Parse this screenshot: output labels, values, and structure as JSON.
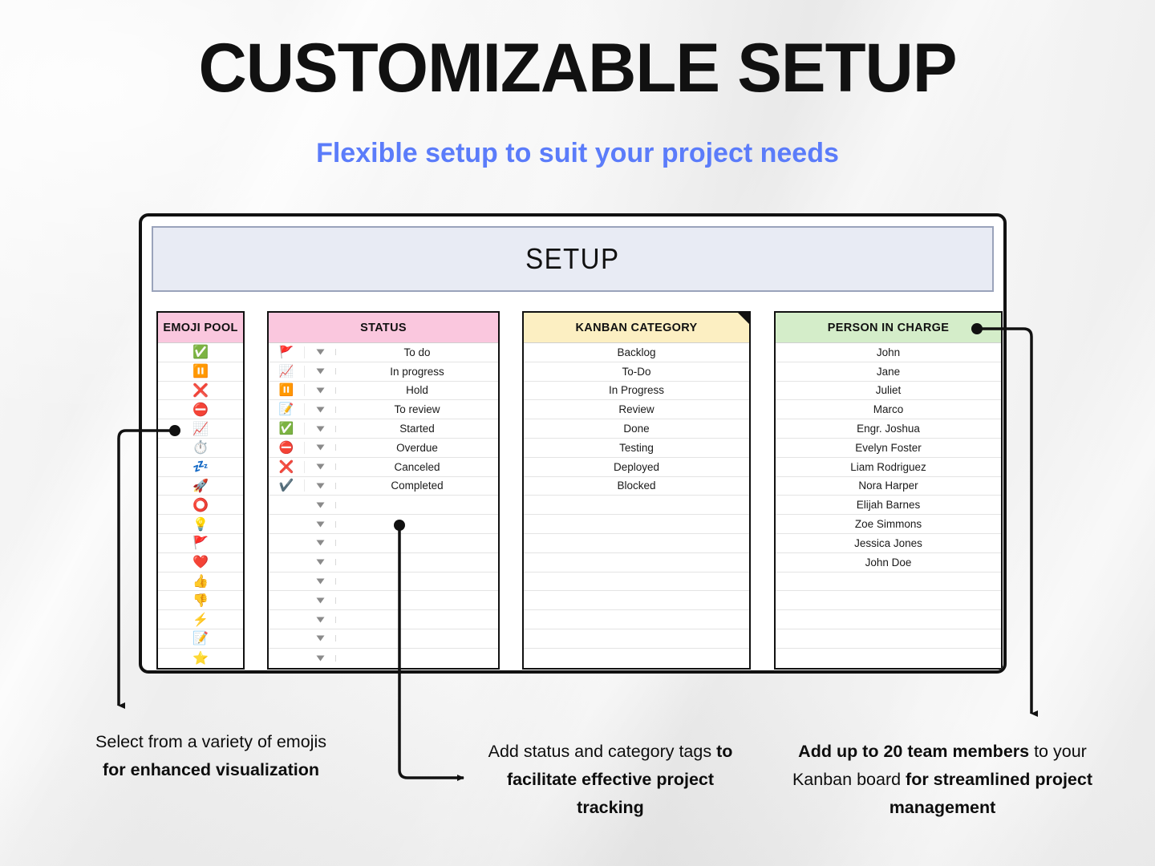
{
  "page": {
    "title": "CUSTOMIZABLE SETUP",
    "subtitle": "Flexible setup to suit your project needs"
  },
  "colors": {
    "accent_blue": "#5B7CFA",
    "banner_bg": "#E8EBF4",
    "pink_header": "#FAC7DE",
    "yellow_header": "#FCEFC2",
    "green_header": "#D4EDC9",
    "frame_border": "#111111"
  },
  "spreadsheet": {
    "banner_title": "SETUP",
    "columns": {
      "emoji_pool": {
        "header": "EMOJI POOL",
        "header_color": "#FAC7DE",
        "items": [
          "✅",
          "⏸️",
          "❌",
          "⛔",
          "📈",
          "⏱️",
          "💤",
          "🚀",
          "⭕",
          "💡",
          "🚩",
          "❤️",
          "👍",
          "👎",
          "⚡",
          "📝",
          "⭐"
        ],
        "icon_names": [
          "check-mark-button-icon",
          "pause-button-icon",
          "cross-mark-icon",
          "no-entry-icon",
          "chart-increasing-icon",
          "stopwatch-icon",
          "zzz-sleep-icon",
          "rocket-icon",
          "hollow-red-circle-icon",
          "light-bulb-icon",
          "triangular-flag-icon",
          "red-heart-icon",
          "thumbs-up-icon",
          "thumbs-down-icon",
          "high-voltage-icon",
          "memo-icon",
          "star-icon"
        ]
      },
      "status": {
        "header": "STATUS",
        "header_color": "#FAC7DE",
        "total_rows": 17,
        "items": [
          {
            "emoji": "🚩",
            "icon_name": "triangular-flag-icon",
            "label": "To do"
          },
          {
            "emoji": "📈",
            "icon_name": "chart-increasing-icon",
            "label": "In progress"
          },
          {
            "emoji": "⏸️",
            "icon_name": "pause-button-icon",
            "label": "Hold"
          },
          {
            "emoji": "📝",
            "icon_name": "memo-icon",
            "label": "To review"
          },
          {
            "emoji": "✅",
            "icon_name": "check-mark-button-icon",
            "label": "Started"
          },
          {
            "emoji": "⛔",
            "icon_name": "no-entry-icon",
            "label": "Overdue"
          },
          {
            "emoji": "❌",
            "icon_name": "cross-mark-icon",
            "label": "Canceled"
          },
          {
            "emoji": "✔️",
            "icon_name": "check-mark-icon",
            "label": "Completed"
          }
        ]
      },
      "kanban_category": {
        "header": "KANBAN CATEGORY",
        "header_color": "#FCEFC2",
        "total_rows": 17,
        "items": [
          "Backlog",
          "To-Do",
          "In Progress",
          "Review",
          "Done",
          "Testing",
          "Deployed",
          "Blocked"
        ]
      },
      "person_in_charge": {
        "header": "PERSON IN CHARGE",
        "header_color": "#D4EDC9",
        "total_rows": 17,
        "items": [
          "John",
          "Jane",
          "Juliet",
          "Marco",
          "Engr. Joshua",
          "Evelyn Foster",
          "Liam Rodriguez",
          "Nora Harper",
          "Elijah Barnes",
          "Zoe Simmons",
          "Jessica Jones",
          "John Doe"
        ]
      }
    }
  },
  "callouts": {
    "left": {
      "plain_1": "Select from a variety of emojis ",
      "bold_1": "for enhanced visualization",
      "plain_2": ""
    },
    "middle": {
      "plain_1": "Add status and category tags ",
      "bold_1": "to facilitate effective project tracking",
      "plain_2": ""
    },
    "right": {
      "plain_1": "",
      "bold_1": "Add up to 20 team members",
      "plain_2": " to your Kanban board ",
      "bold_2": "for streamlined project management"
    }
  }
}
